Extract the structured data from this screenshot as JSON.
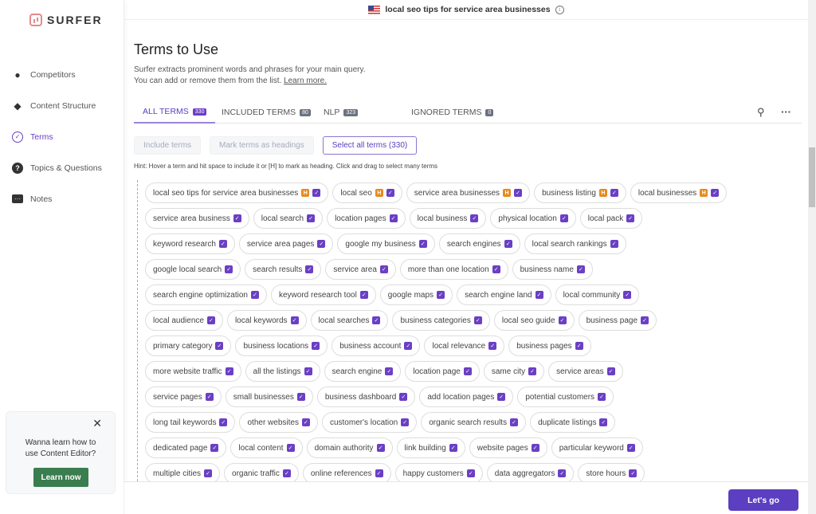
{
  "brand": {
    "name": "SURFER"
  },
  "sidebar": {
    "items": [
      {
        "label": "Competitors",
        "icon": "users-icon"
      },
      {
        "label": "Content Structure",
        "icon": "layers-icon"
      },
      {
        "label": "Terms",
        "icon": "check-circle-icon",
        "active": true
      },
      {
        "label": "Topics & Questions",
        "icon": "question-icon"
      },
      {
        "label": "Notes",
        "icon": "chat-icon"
      }
    ]
  },
  "promo": {
    "text": "Wanna learn how to use Content Editor?",
    "button": "Learn now"
  },
  "header": {
    "query": "local seo tips for service area businesses"
  },
  "main": {
    "title": "Terms to Use",
    "desc1": "Surfer extracts prominent words and phrases for your main query.",
    "desc2": "You can add or remove them from the list.",
    "learn_more": "Learn more.",
    "tabs": [
      {
        "label": "ALL TERMS",
        "count": "330",
        "active": true
      },
      {
        "label": "INCLUDED TERMS",
        "count": "80"
      },
      {
        "label": "NLP",
        "count": "323"
      },
      {
        "label": "IGNORED TERMS",
        "count": "0"
      }
    ],
    "actions": {
      "include": "Include terms",
      "headings": "Mark terms as headings",
      "select_all": "Select all terms (330)"
    },
    "hint": "Hint: Hover a term and hit space to include it or [H] to mark as heading. Click and drag to select many terms",
    "heading_badge": "H",
    "term_rows": [
      [
        {
          "t": "local seo tips for service area businesses",
          "h": true
        },
        {
          "t": "local seo",
          "h": true
        },
        {
          "t": "service area businesses",
          "h": true
        },
        {
          "t": "business listing",
          "h": true
        },
        {
          "t": "local businesses",
          "h": true
        }
      ],
      [
        {
          "t": "service area business"
        },
        {
          "t": "local search"
        },
        {
          "t": "location pages"
        },
        {
          "t": "local business"
        },
        {
          "t": "physical location"
        },
        {
          "t": "local pack"
        }
      ],
      [
        {
          "t": "keyword research"
        },
        {
          "t": "service area pages"
        },
        {
          "t": "google my business"
        },
        {
          "t": "search engines"
        },
        {
          "t": "local search rankings"
        }
      ],
      [
        {
          "t": "google local search"
        },
        {
          "t": "search results"
        },
        {
          "t": "service area"
        },
        {
          "t": "more than one location"
        },
        {
          "t": "business name"
        }
      ],
      [
        {
          "t": "search engine optimization"
        },
        {
          "t": "keyword research tool"
        },
        {
          "t": "google maps"
        },
        {
          "t": "search engine land"
        },
        {
          "t": "local community"
        }
      ],
      [
        {
          "t": "local audience"
        },
        {
          "t": "local keywords"
        },
        {
          "t": "local searches"
        },
        {
          "t": "business categories"
        },
        {
          "t": "local seo guide"
        },
        {
          "t": "business page"
        }
      ],
      [
        {
          "t": "primary category"
        },
        {
          "t": "business locations"
        },
        {
          "t": "business account"
        },
        {
          "t": "local relevance"
        },
        {
          "t": "business pages"
        }
      ],
      [
        {
          "t": "more website traffic"
        },
        {
          "t": "all the listings"
        },
        {
          "t": "search engine"
        },
        {
          "t": "location page"
        },
        {
          "t": "same city"
        },
        {
          "t": "service areas"
        }
      ],
      [
        {
          "t": "service pages"
        },
        {
          "t": "small businesses"
        },
        {
          "t": "business dashboard"
        },
        {
          "t": "add location pages"
        },
        {
          "t": "potential customers"
        }
      ],
      [
        {
          "t": "long tail keywords"
        },
        {
          "t": "other websites"
        },
        {
          "t": "customer's location"
        },
        {
          "t": "organic search results"
        },
        {
          "t": "duplicate listings"
        }
      ],
      [
        {
          "t": "dedicated page"
        },
        {
          "t": "local content"
        },
        {
          "t": "domain authority"
        },
        {
          "t": "link building"
        },
        {
          "t": "website pages"
        },
        {
          "t": "particular keyword"
        }
      ],
      [
        {
          "t": "multiple cities"
        },
        {
          "t": "organic traffic"
        },
        {
          "t": "online references"
        },
        {
          "t": "happy customers"
        },
        {
          "t": "data aggregators"
        },
        {
          "t": "store hours"
        }
      ]
    ]
  },
  "footer": {
    "button": "Let's go"
  },
  "colors": {
    "accent": "#5b3fc0",
    "heading": "#e88a1e",
    "learn": "#3a7d4f"
  }
}
